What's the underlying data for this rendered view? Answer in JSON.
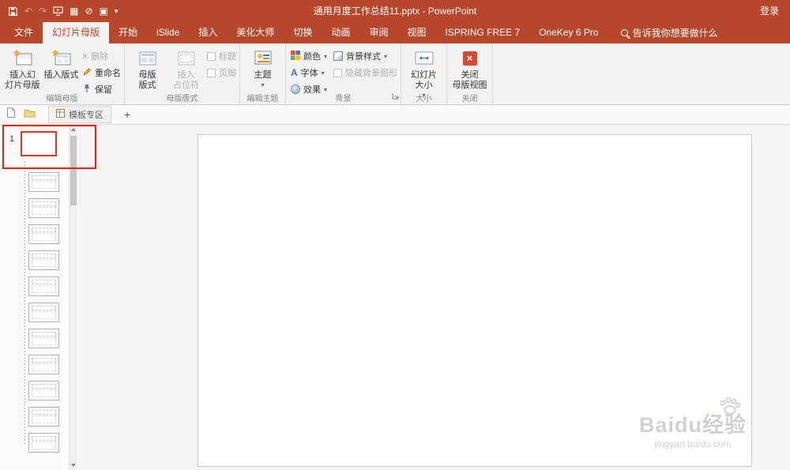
{
  "titlebar": {
    "title": "通用月度工作总结11.pptx - PowerPoint",
    "sign_in": "登录"
  },
  "tabs": [
    {
      "label": "文件"
    },
    {
      "label": "幻灯片母版",
      "active": true
    },
    {
      "label": "开始"
    },
    {
      "label": "iSlide"
    },
    {
      "label": "插入"
    },
    {
      "label": "美化大师"
    },
    {
      "label": "切换"
    },
    {
      "label": "动画"
    },
    {
      "label": "审阅"
    },
    {
      "label": "视图"
    },
    {
      "label": "ISPRING FREE 7"
    },
    {
      "label": "OneKey 6 Pro"
    }
  ],
  "tell_me": "告诉我你想要做什么",
  "ribbon": {
    "edit_master": {
      "group_label": "编辑母版",
      "insert_master": {
        "line1": "插入幻",
        "line2": "灯片母版"
      },
      "insert_layout": "插入版式",
      "delete": "删除",
      "rename": "重命名",
      "preserve": "保留"
    },
    "master_layout_group": {
      "group_label": "母版版式",
      "master_layout": {
        "line1": "母版",
        "line2": "版式"
      },
      "insert_placeholder": {
        "line1": "插入",
        "line2": "占位符"
      },
      "title_chk": "标题",
      "footer_chk": "页脚"
    },
    "edit_theme": {
      "group_label": "编辑主题",
      "themes": "主题"
    },
    "background": {
      "group_label": "背景",
      "colors": "颜色",
      "fonts": "字体",
      "effects": "效果",
      "bg_styles": "背景样式",
      "hide_bg": "隐藏背景图形"
    },
    "size": {
      "group_label": "大小",
      "slide_size": {
        "line1": "幻灯片",
        "line2": "大小"
      }
    },
    "close": {
      "group_label": "关闭",
      "close_btn": {
        "line1": "关闭",
        "line2": "母版视图"
      }
    }
  },
  "doc_bar": {
    "template_tab": "模板专区",
    "new_tab": "+"
  },
  "panel": {
    "slide_number": "1"
  },
  "watermark": {
    "brand": "Baidu",
    "suffix": "经验",
    "url": "jingyan.baidu.com"
  },
  "icons": {
    "undo": "↶",
    "redo": "↷",
    "grid": "▦",
    "prohibit": "⊘",
    "picture": "▣",
    "dropdown": "▾",
    "delete_x": "×",
    "close_x": "×",
    "fonts_a": "A"
  },
  "colors": {
    "accent_red": "#B7472A",
    "annotation_red": "#EE1D0E"
  }
}
